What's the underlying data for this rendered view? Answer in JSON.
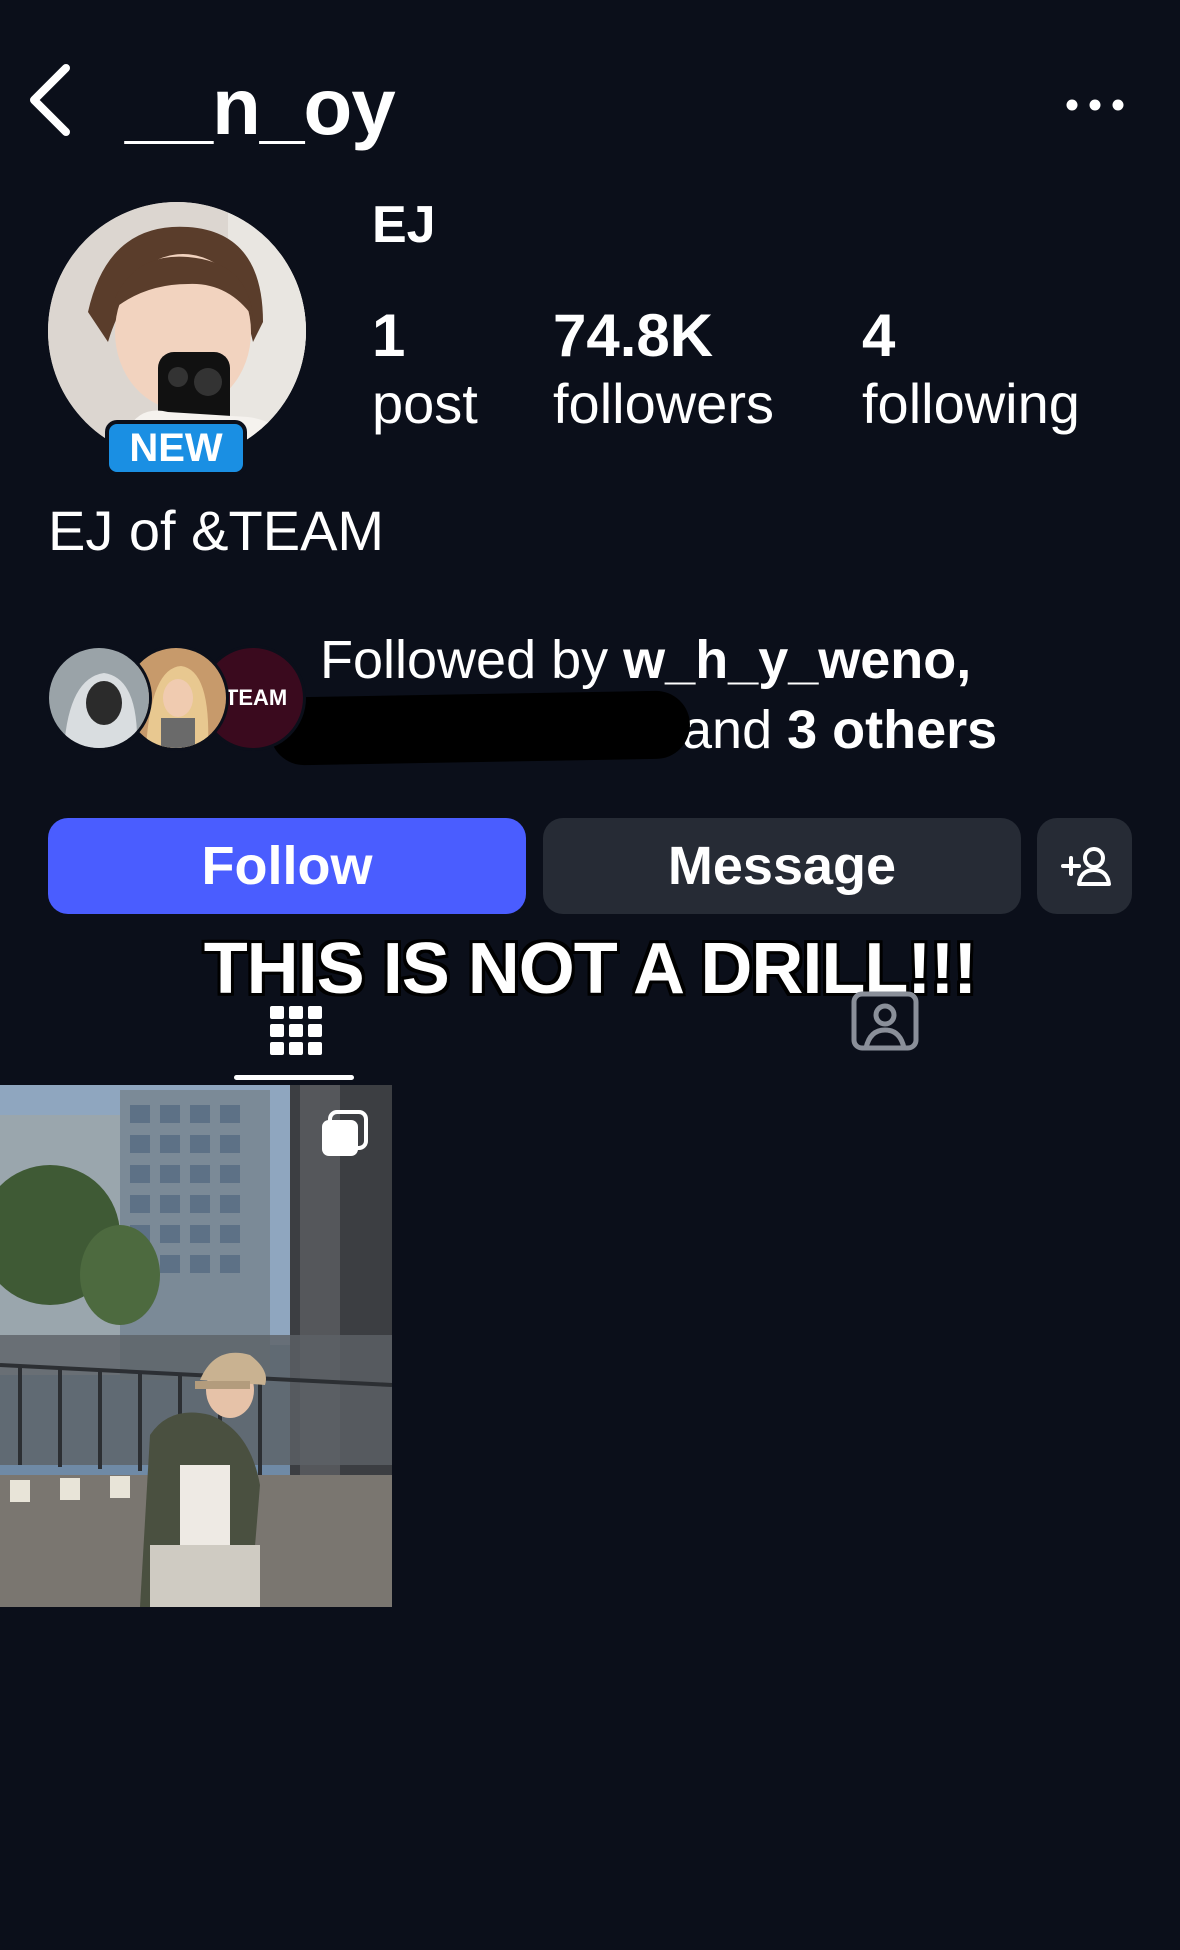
{
  "header": {
    "username": "__n_oy",
    "back_icon": "chevron-left-icon",
    "more_icon": "ellipsis-icon"
  },
  "profile": {
    "display_name": "EJ",
    "new_badge": "NEW",
    "bio": "EJ of &TEAM",
    "stats": [
      {
        "value": "1",
        "label": "post"
      },
      {
        "value": "74.8K",
        "label": "followers"
      },
      {
        "value": "4",
        "label": "following"
      }
    ]
  },
  "followed_by": {
    "prefix": "Followed by ",
    "user": "w_h_y_weno,",
    "suffix_prefix": "and ",
    "others": "3 others",
    "third_avatar_text": ".TEAM"
  },
  "actions": {
    "follow": "Follow",
    "message": "Message",
    "add_user_icon": "add-user-icon"
  },
  "overlay": {
    "caption": "THIS IS NOT A DRILL!!!"
  },
  "tabs": {
    "active": "grid",
    "items": [
      "grid-icon",
      "tagged-icon"
    ]
  },
  "colors": {
    "background": "#0b0f1a",
    "follow_button": "#4a5dff",
    "secondary_button": "#262b35",
    "new_badge": "#1a8fe3"
  }
}
